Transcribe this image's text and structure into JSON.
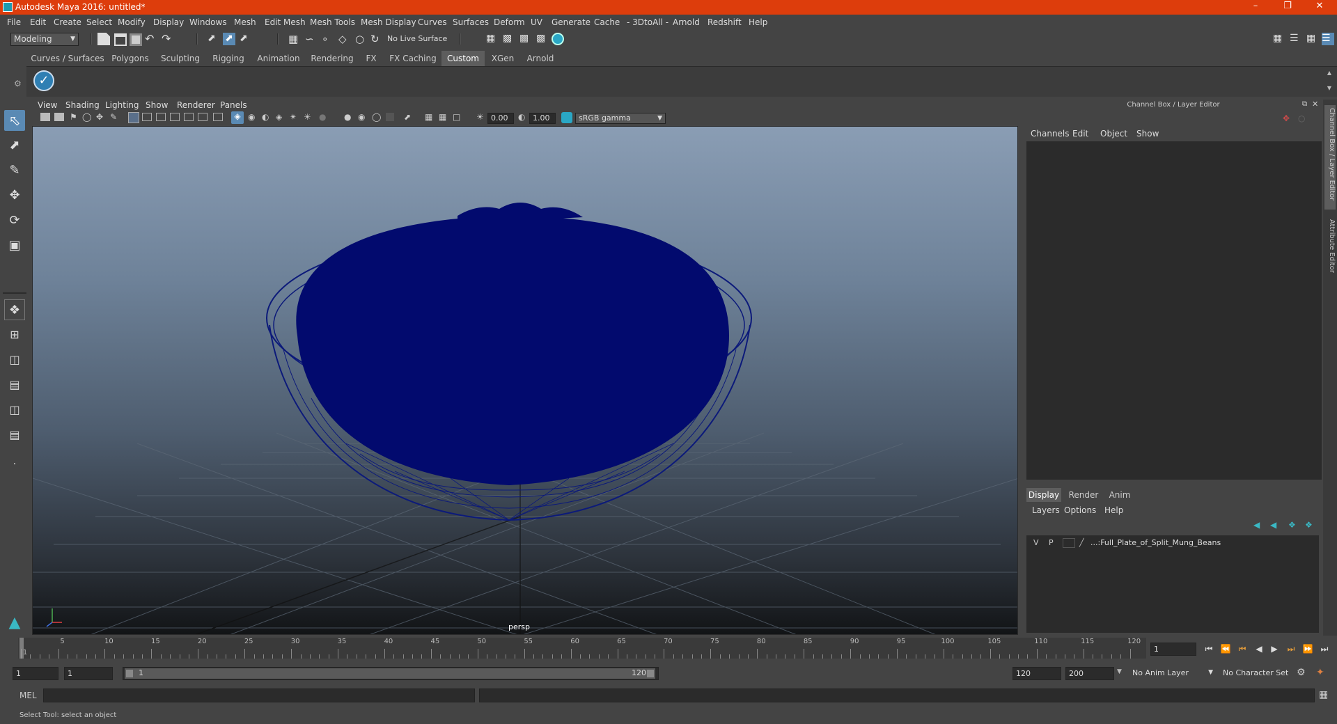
{
  "window": {
    "title": "Autodesk Maya 2016: untitled*"
  },
  "menubar": [
    "File",
    "Edit",
    "Create",
    "Select",
    "Modify",
    "Display",
    "Windows",
    "Mesh",
    "Edit Mesh",
    "Mesh Tools",
    "Mesh Display",
    "Curves",
    "Surfaces",
    "Deform",
    "UV",
    "Generate",
    "Cache",
    "- 3DtoAll -",
    "Arnold",
    "Redshift",
    "Help"
  ],
  "statusline": {
    "mode": "Modeling",
    "live_surface": "No Live Surface"
  },
  "shelf": {
    "tabs": [
      "Curves / Surfaces",
      "Polygons",
      "Sculpting",
      "Rigging",
      "Animation",
      "Rendering",
      "FX",
      "FX Caching",
      "Custom",
      "XGen",
      "Arnold"
    ],
    "active_tab": "Custom"
  },
  "panel": {
    "menus": [
      "View",
      "Shading",
      "Lighting",
      "Show",
      "Renderer",
      "Panels"
    ],
    "exposure": "0.00",
    "gamma": "1.00",
    "color_space": "sRGB gamma",
    "camera_label": "persp"
  },
  "channel_box": {
    "title": "Channel Box / Layer Editor",
    "menus": [
      "Channels",
      "Edit",
      "Object",
      "Show"
    ],
    "layer_tabs": [
      "Display",
      "Render",
      "Anim"
    ],
    "active_layer_tab": "Display",
    "layer_menus": [
      "Layers",
      "Options",
      "Help"
    ],
    "layer": {
      "v": "V",
      "p": "P",
      "name": "...:Full_Plate_of_Split_Mung_Beans"
    }
  },
  "side_tabs": [
    "Channel Box / Layer Editor",
    "Attribute Editor"
  ],
  "timeline": {
    "tick_labels": [
      "1",
      "5",
      "10",
      "15",
      "20",
      "25",
      "30",
      "35",
      "40",
      "45",
      "50",
      "55",
      "60",
      "65",
      "70",
      "75",
      "80",
      "85",
      "90",
      "95",
      "100",
      "105",
      "110",
      "115",
      "120"
    ],
    "current_frame": "1"
  },
  "range": {
    "start": "1",
    "playback_start": "1",
    "slider_start": "1",
    "slider_end": "120",
    "playback_end": "120",
    "end": "200",
    "anim_layer": "No Anim Layer",
    "character_set": "No Character Set"
  },
  "command_line": {
    "language": "MEL"
  },
  "help_line": {
    "text": "Select Tool: select an object"
  }
}
